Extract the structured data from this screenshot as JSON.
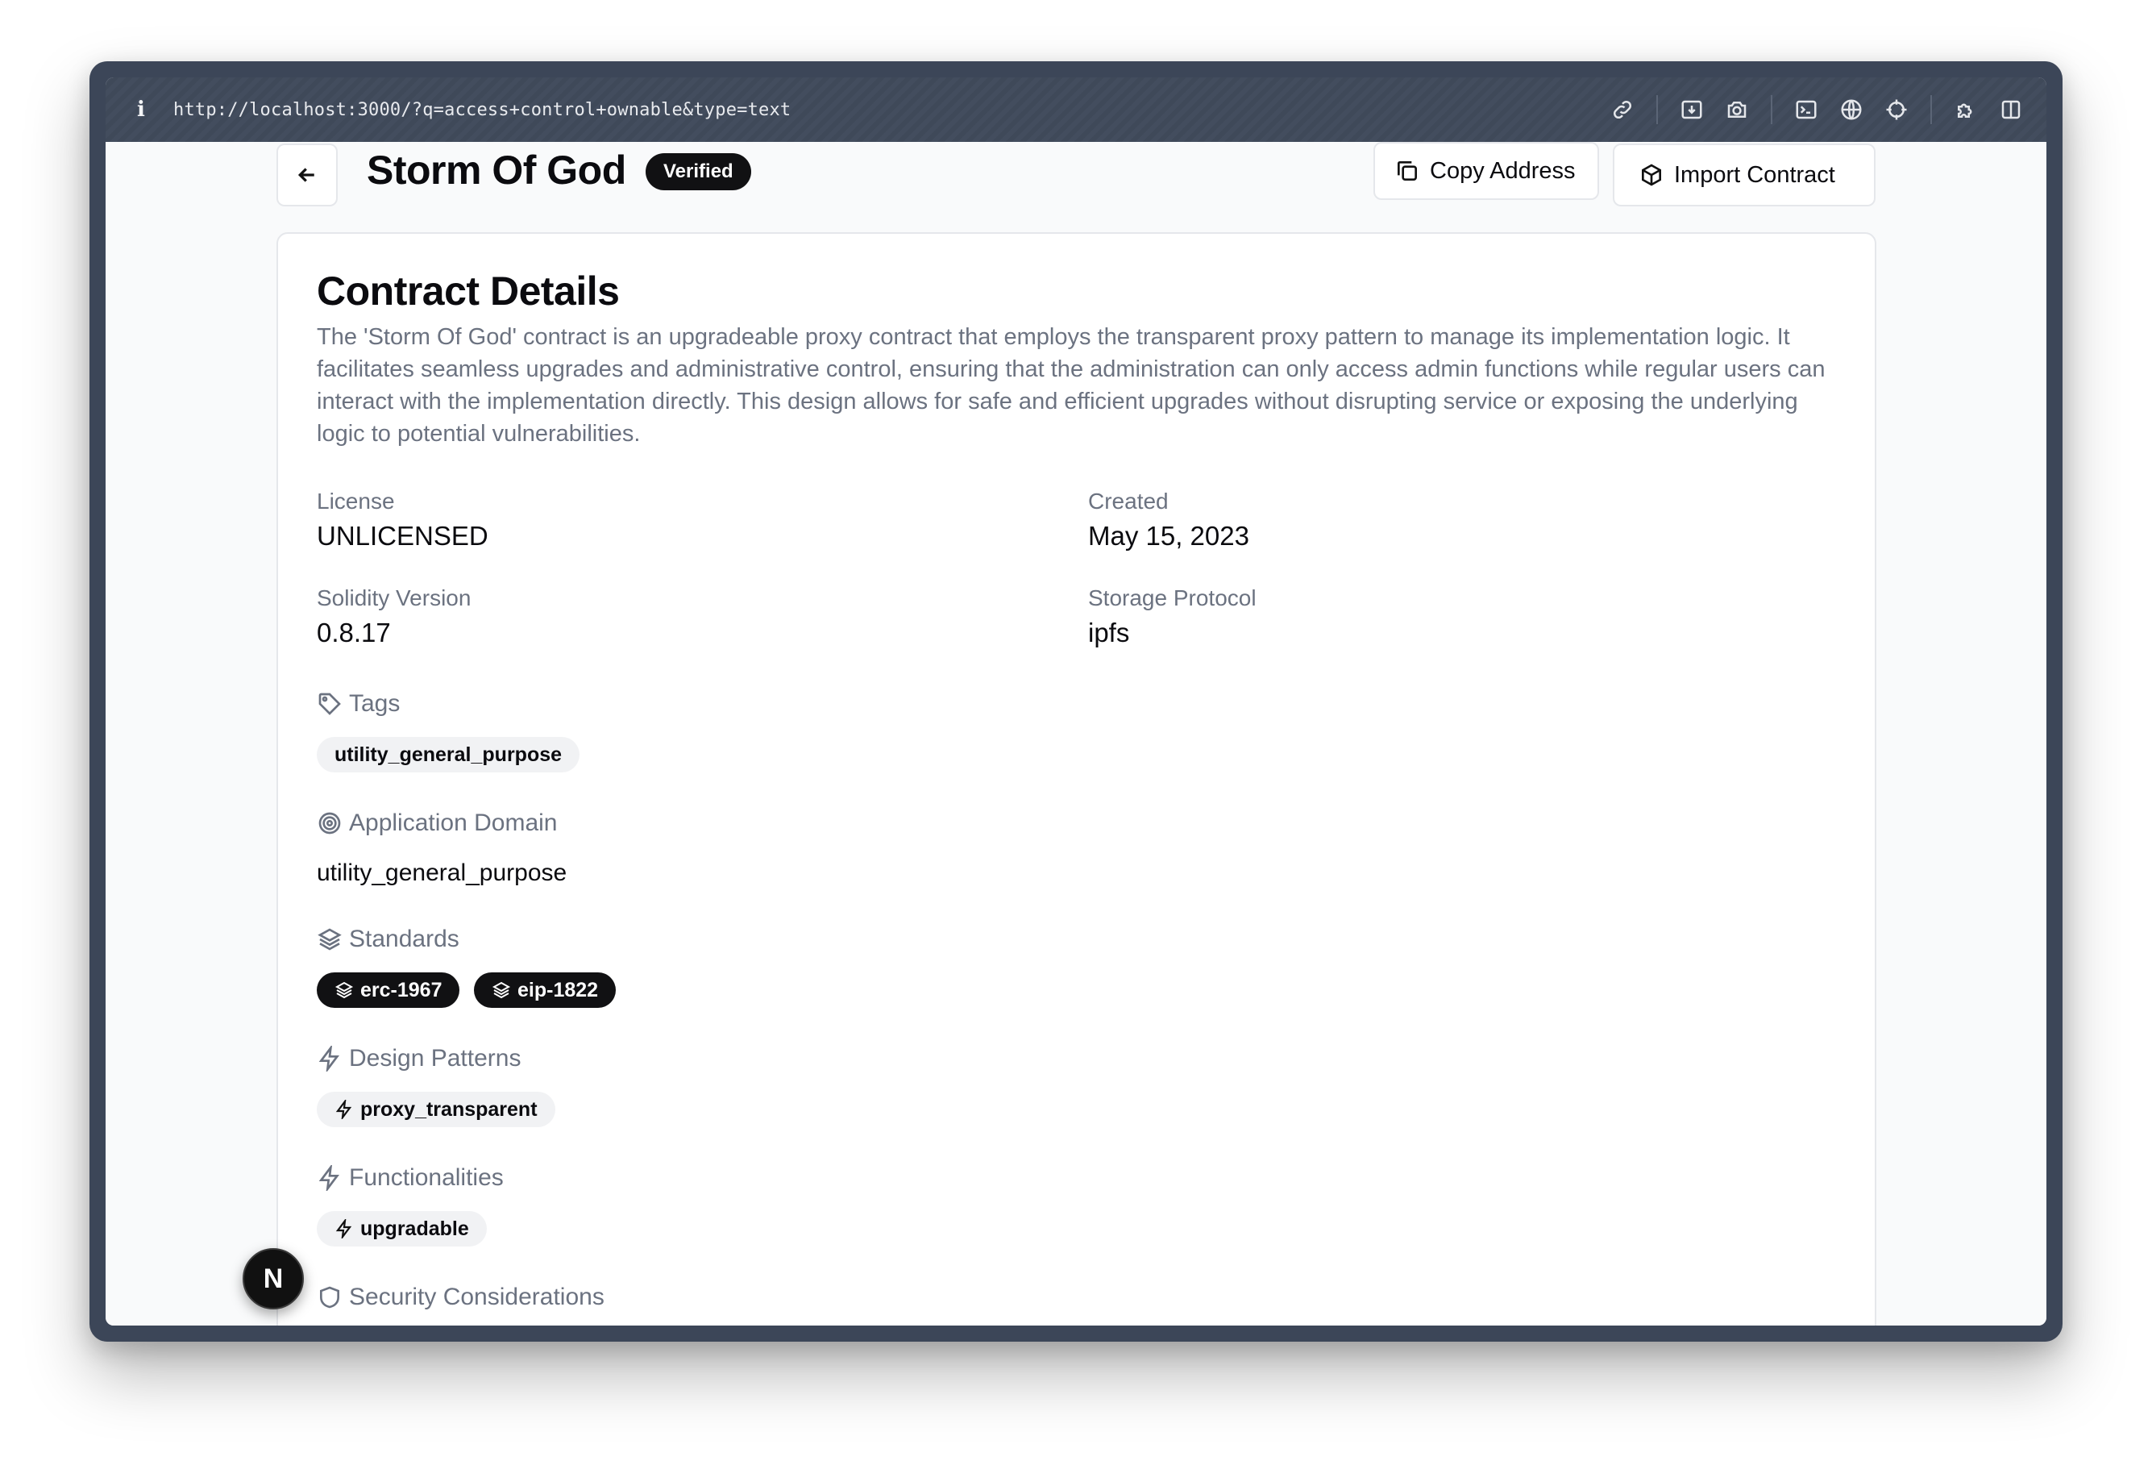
{
  "browser": {
    "url": "http://localhost:3000/?q=access+control+ownable&type=text",
    "info_icon": "i",
    "toolbar_icons": [
      "link-icon",
      "download-icon",
      "camera-icon",
      "terminal-icon",
      "globe-icon",
      "crosshair-icon",
      "extension-icon",
      "sidebar-icon"
    ]
  },
  "header": {
    "title": "Storm Of God",
    "badge": "Verified",
    "copy_label": "Copy Address",
    "import_label": "Import Contract"
  },
  "details": {
    "heading": "Contract Details",
    "description": "The 'Storm Of God' contract is an upgradeable proxy contract that employs the transparent proxy pattern to manage its implementation logic. It facilitates seamless upgrades and administrative control, ensuring that the administration can only access admin functions while regular users can interact with the implementation directly. This design allows for safe and efficient upgrades without disrupting service or exposing the underlying logic to potential vulnerabilities.",
    "fields": {
      "license_label": "License",
      "license_value": "UNLICENSED",
      "created_label": "Created",
      "created_value": "May 15, 2023",
      "solidity_label": "Solidity Version",
      "solidity_value": "0.8.17",
      "storage_label": "Storage Protocol",
      "storage_value": "ipfs"
    },
    "tags": {
      "label": "Tags",
      "items": [
        "utility_general_purpose"
      ]
    },
    "domain": {
      "label": "Application Domain",
      "value": "utility_general_purpose"
    },
    "standards": {
      "label": "Standards",
      "items": [
        "erc-1967",
        "eip-1822"
      ]
    },
    "patterns": {
      "label": "Design Patterns",
      "items": [
        "proxy_transparent"
      ]
    },
    "functionalities": {
      "label": "Functionalities",
      "items": [
        "upgradable"
      ]
    },
    "security": {
      "label": "Security Considerations"
    }
  },
  "next_badge": "N",
  "colors": {
    "accent_dark": "#111113",
    "muted_text": "#6b7280",
    "pill_bg": "#f1f2f4"
  }
}
